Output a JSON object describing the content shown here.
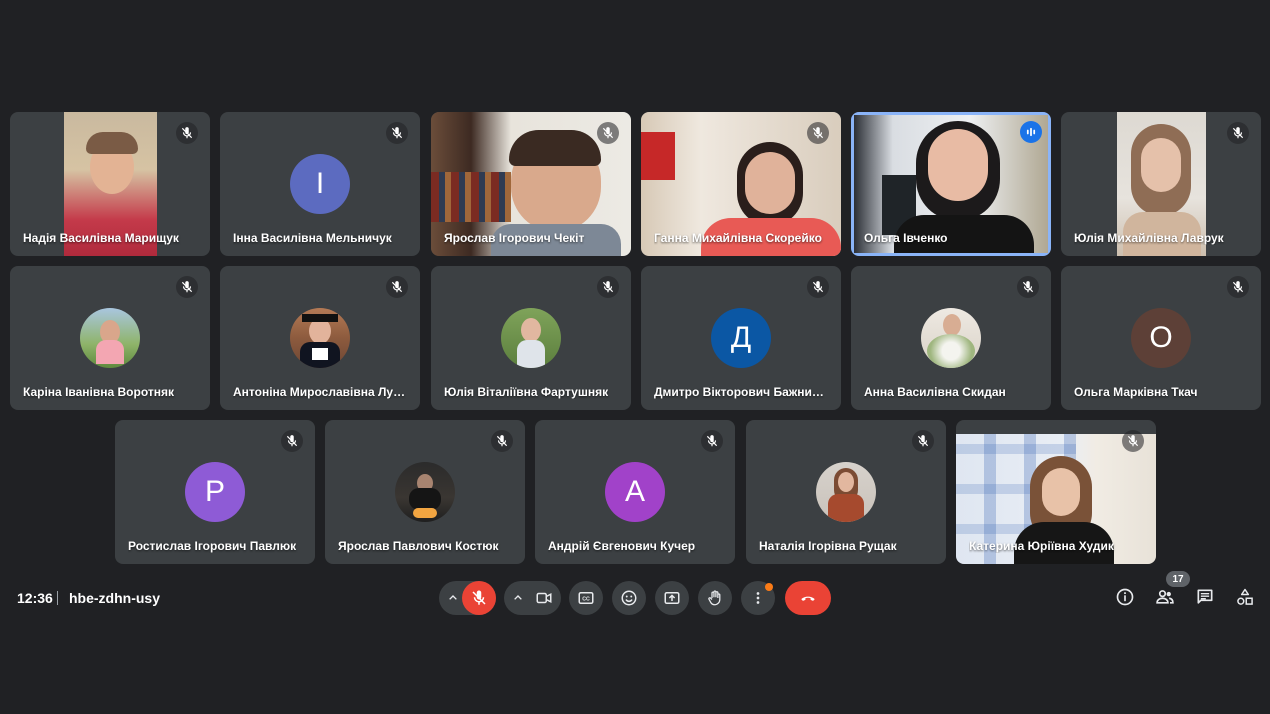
{
  "meeting": {
    "time": "12:36",
    "code": "hbe-zdhn-usy",
    "participant_count": "17"
  },
  "participants": [
    {
      "name": "Надія Василівна Марищук",
      "type": "video",
      "muted": true
    },
    {
      "name": "Інна Василівна Мельничук",
      "type": "letter",
      "letter": "І",
      "color": "#5c6bc0",
      "muted": true
    },
    {
      "name": "Ярослав Ігорович Чекіт",
      "type": "video",
      "muted": true
    },
    {
      "name": "Ганна Михайлівна Скорейко",
      "type": "video",
      "muted": true
    },
    {
      "name": "Ольга Івченко",
      "type": "video",
      "speaking": true
    },
    {
      "name": "Юлія Михайлівна Лаврук",
      "type": "video",
      "muted": true
    },
    {
      "name": "Каріна Іванівна Воротняк",
      "type": "photo",
      "muted": true
    },
    {
      "name": "Антоніна Мирославівна Лук...",
      "type": "photo",
      "muted": true
    },
    {
      "name": "Юлія Віталіївна Фартушняк",
      "type": "photo",
      "muted": true
    },
    {
      "name": "Дмитро Вікторович Бажниць...",
      "type": "letter",
      "letter": "Д",
      "color": "#0b57a4",
      "muted": true
    },
    {
      "name": "Анна Василівна Скидан",
      "type": "photo",
      "muted": true
    },
    {
      "name": "Ольга Марківна Ткач",
      "type": "letter",
      "letter": "О",
      "color": "#5d4037",
      "muted": true
    },
    {
      "name": "Ростислав Ігорович Павлюк",
      "type": "letter",
      "letter": "Р",
      "color": "#8e5bd6",
      "muted": true
    },
    {
      "name": "Ярослав Павлович Костюк",
      "type": "photo",
      "muted": true
    },
    {
      "name": "Андрій Євгенович Кучер",
      "type": "letter",
      "letter": "А",
      "color": "#a142c9",
      "muted": true
    },
    {
      "name": "Наталія Ігорівна Рущак",
      "type": "photo",
      "muted": true
    },
    {
      "name": "Катерина Юріївна Худик",
      "type": "video",
      "muted": true
    }
  ],
  "controls": {
    "mic": "mic-off-icon",
    "camera": "camera-icon",
    "captions": "captions-icon",
    "reactions": "emoji-icon",
    "present": "present-icon",
    "raise_hand": "hand-icon",
    "more": "more-vert-icon",
    "leave": "end-call-icon"
  },
  "colors": {
    "background": "#202124",
    "tile": "#3c4043",
    "accent": "#8ab4f8",
    "danger": "#ea4335"
  }
}
